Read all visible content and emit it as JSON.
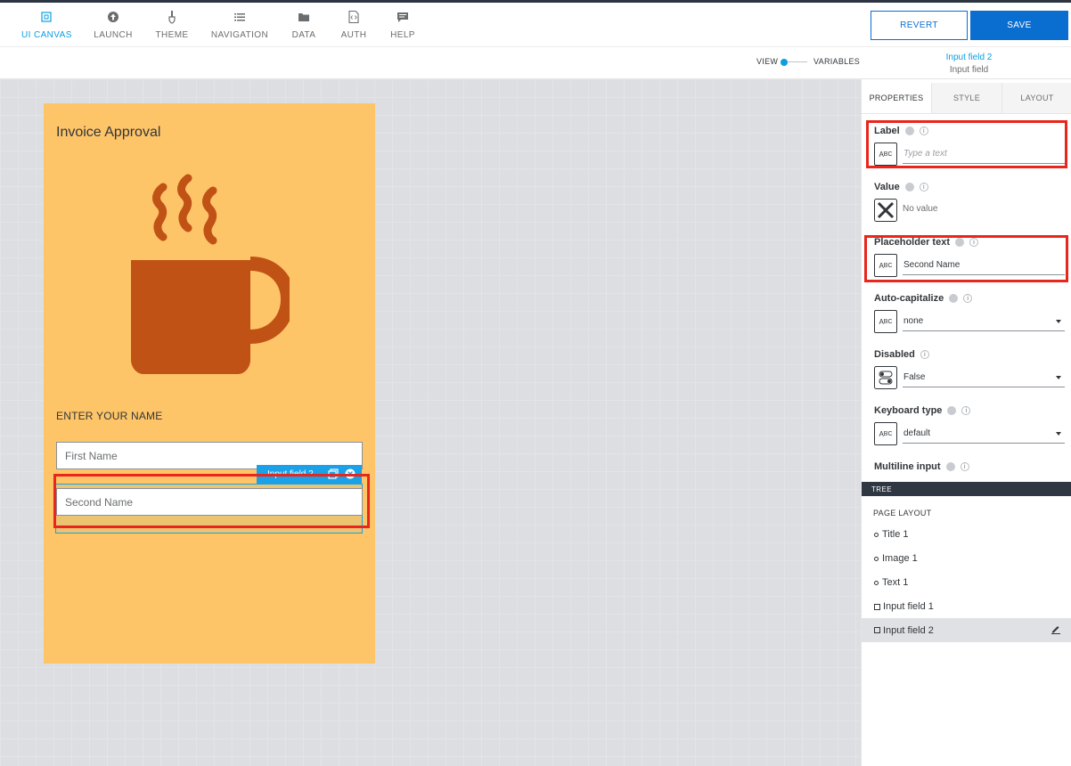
{
  "toolbar": {
    "nav": [
      {
        "label": "UI CANVAS",
        "icon": "canvas-icon",
        "active": true
      },
      {
        "label": "LAUNCH",
        "icon": "upload-icon"
      },
      {
        "label": "THEME",
        "icon": "brush-icon"
      },
      {
        "label": "NAVIGATION",
        "icon": "list-icon"
      },
      {
        "label": "DATA",
        "icon": "folder-icon"
      },
      {
        "label": "AUTH",
        "icon": "code-file-icon"
      },
      {
        "label": "HELP",
        "icon": "chat-icon"
      }
    ],
    "revert_label": "REVERT",
    "save_label": "SAVE"
  },
  "subbar": {
    "view_label": "VIEW",
    "variables_label": "VARIABLES",
    "selected_name": "Input field 2",
    "selected_type": "Input field"
  },
  "canvas": {
    "title": "Invoice Approval",
    "image_icon": "coffee-mug-icon",
    "section_text": "ENTER YOUR NAME",
    "input1_placeholder": "First Name",
    "input2_placeholder": "Second Name",
    "selection_tag": "Input field 2"
  },
  "panel": {
    "tabs": [
      "PROPERTIES",
      "STYLE",
      "LAYOUT"
    ],
    "properties": {
      "label": {
        "name": "Label",
        "placeholder": "Type a text"
      },
      "value": {
        "name": "Value",
        "text": "No value"
      },
      "placeholder_text": {
        "name": "Placeholder text",
        "value": "Second Name"
      },
      "auto_capitalize": {
        "name": "Auto-capitalize",
        "value": "none"
      },
      "disabled": {
        "name": "Disabled",
        "value": "False"
      },
      "keyboard_type": {
        "name": "Keyboard type",
        "value": "default"
      },
      "multiline": {
        "name": "Multiline input"
      }
    },
    "tree": {
      "bar_label": "TREE",
      "heading": "PAGE LAYOUT",
      "items": [
        "Title 1",
        "Image 1",
        "Text 1",
        "Input field 1",
        "Input field 2"
      ]
    }
  },
  "colors": {
    "accent": "#0a6ed1",
    "selection": "#1aa1e8",
    "phone_bg": "#fec468",
    "mug": "#c05215",
    "highlight": "#e8261b"
  }
}
